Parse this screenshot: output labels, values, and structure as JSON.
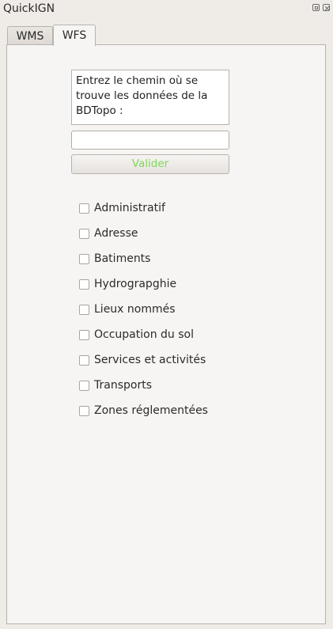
{
  "window": {
    "title": "QuickIGN"
  },
  "tabs": [
    {
      "label": "WMS",
      "active": false
    },
    {
      "label": "WFS",
      "active": true
    }
  ],
  "wfs": {
    "path_prompt": "Entrez le chemin où se trouve les données de la BDTopo :",
    "path_value": "",
    "path_placeholder": "",
    "validate_label": "Valider",
    "validate_color": "#7ed957",
    "layers": [
      {
        "label": "Administratif",
        "checked": false
      },
      {
        "label": "Adresse",
        "checked": false
      },
      {
        "label": "Batiments",
        "checked": false
      },
      {
        "label": "Hydrograpghie",
        "checked": false
      },
      {
        "label": "Lieux nommés",
        "checked": false
      },
      {
        "label": "Occupation du sol",
        "checked": false
      },
      {
        "label": "Services et activités",
        "checked": false
      },
      {
        "label": "Transports",
        "checked": false
      },
      {
        "label": "Zones réglementées",
        "checked": false
      }
    ]
  }
}
